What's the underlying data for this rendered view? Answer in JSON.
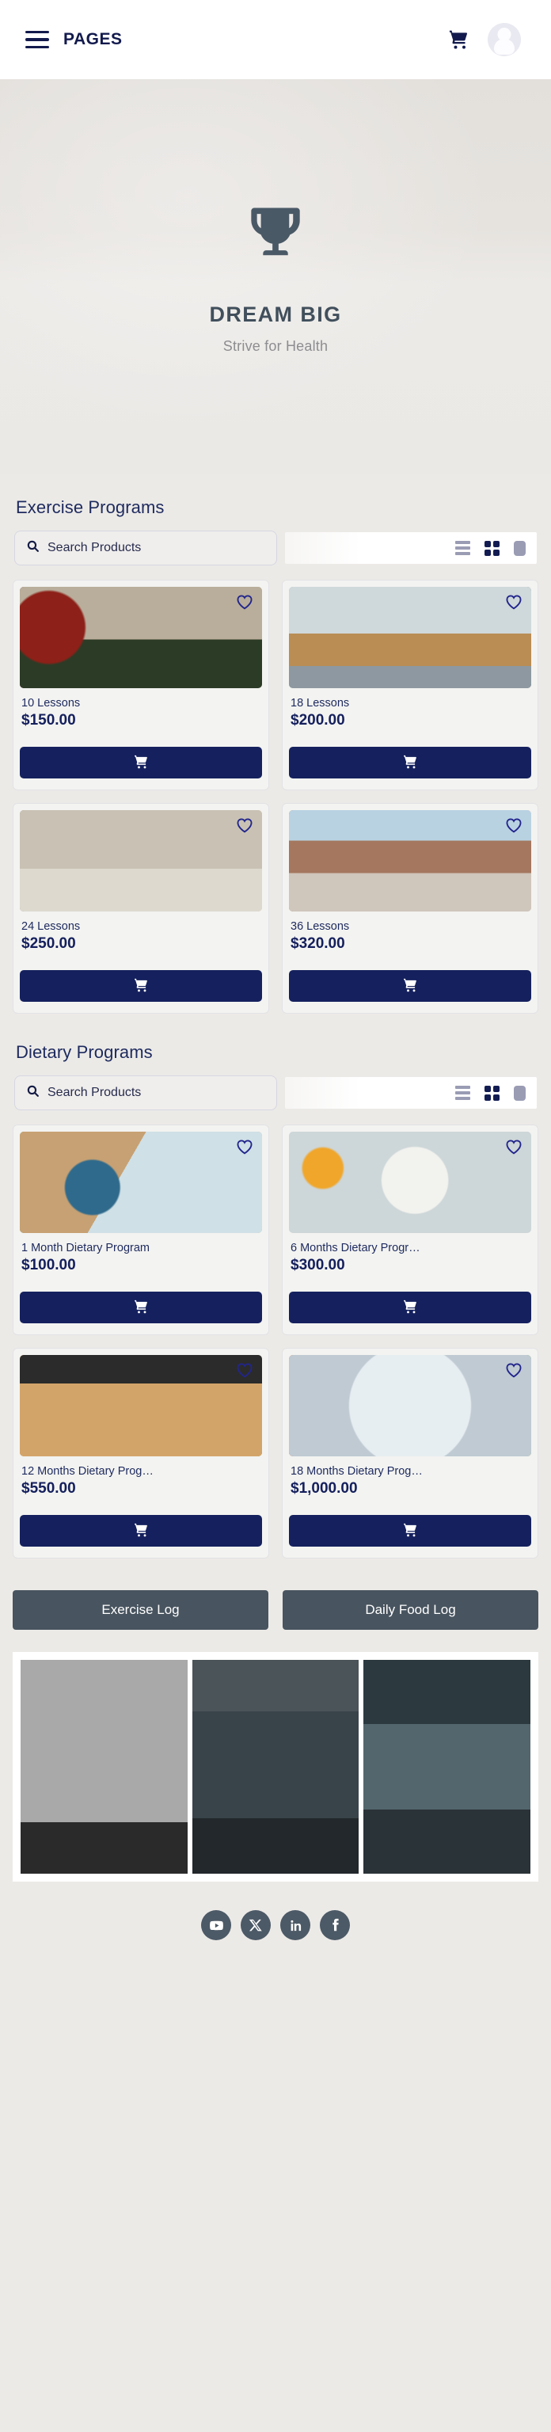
{
  "header": {
    "menu_label": "PAGES",
    "menu_icon": "hamburger-icon",
    "cart_icon": "shopping-cart-icon",
    "avatar_icon": "user-avatar-placeholder"
  },
  "hero": {
    "logo_icon": "trophy-star-icon",
    "title": "DREAM BIG",
    "subtitle": "Strive for Health"
  },
  "sections": [
    {
      "id": "exercise",
      "title": "Exercise Programs",
      "search": {
        "placeholder": "Search Products",
        "icon": "search-icon",
        "value": ""
      },
      "view_toggle": {
        "options": [
          "list-view-icon",
          "grid-view-icon",
          "single-view-icon"
        ],
        "active": "grid-view-icon"
      },
      "products": [
        {
          "title": "10 Lessons",
          "price": "$150.00",
          "favorite_icon": "heart-outline-icon",
          "cart_icon": "shopping-cart-icon",
          "image": "ph-pushup"
        },
        {
          "title": "18 Lessons",
          "price": "$200.00",
          "favorite_icon": "heart-outline-icon",
          "cart_icon": "shopping-cart-icon",
          "image": "ph-box"
        },
        {
          "title": "24 Lessons",
          "price": "$250.00",
          "favorite_icon": "heart-outline-icon",
          "cart_icon": "shopping-cart-icon",
          "image": "ph-highfive"
        },
        {
          "title": "36 Lessons",
          "price": "$320.00",
          "favorite_icon": "heart-outline-icon",
          "cart_icon": "shopping-cart-icon",
          "image": "ph-mat"
        }
      ]
    },
    {
      "id": "dietary",
      "title": "Dietary Programs",
      "search": {
        "placeholder": "Search Products",
        "icon": "search-icon",
        "value": ""
      },
      "view_toggle": {
        "options": [
          "list-view-icon",
          "grid-view-icon",
          "single-view-icon"
        ],
        "active": "grid-view-icon"
      },
      "products": [
        {
          "title": "1 Month Dietary Program",
          "price": "$100.00",
          "favorite_icon": "heart-outline-icon",
          "cart_icon": "shopping-cart-icon",
          "image": "ph-salad"
        },
        {
          "title": "6 Months Dietary Progr…",
          "price": "$300.00",
          "favorite_icon": "heart-outline-icon",
          "cart_icon": "shopping-cart-icon",
          "image": "ph-bowl"
        },
        {
          "title": "12 Months Dietary Prog…",
          "price": "$550.00",
          "favorite_icon": "heart-outline-icon",
          "cart_icon": "shopping-cart-icon",
          "image": "ph-carrot"
        },
        {
          "title": "18 Months Dietary Prog…",
          "price": "$1,000.00",
          "favorite_icon": "heart-outline-icon",
          "cart_icon": "shopping-cart-icon",
          "image": "ph-plate"
        }
      ]
    }
  ],
  "logs": {
    "exercise_log_label": "Exercise Log",
    "food_log_label": "Daily Food Log"
  },
  "gallery": {
    "images": [
      "ph-rope",
      "ph-squat",
      "ph-flex"
    ]
  },
  "footer": {
    "socials": [
      {
        "name": "youtube-icon"
      },
      {
        "name": "x-twitter-icon"
      },
      {
        "name": "linkedin-icon"
      },
      {
        "name": "facebook-icon"
      }
    ]
  },
  "colors": {
    "navy": "#15215e",
    "title_navy": "#1d2a5e",
    "slate": "#48545f",
    "hero_title": "#414f5c",
    "page_bg": "#eceae7"
  }
}
